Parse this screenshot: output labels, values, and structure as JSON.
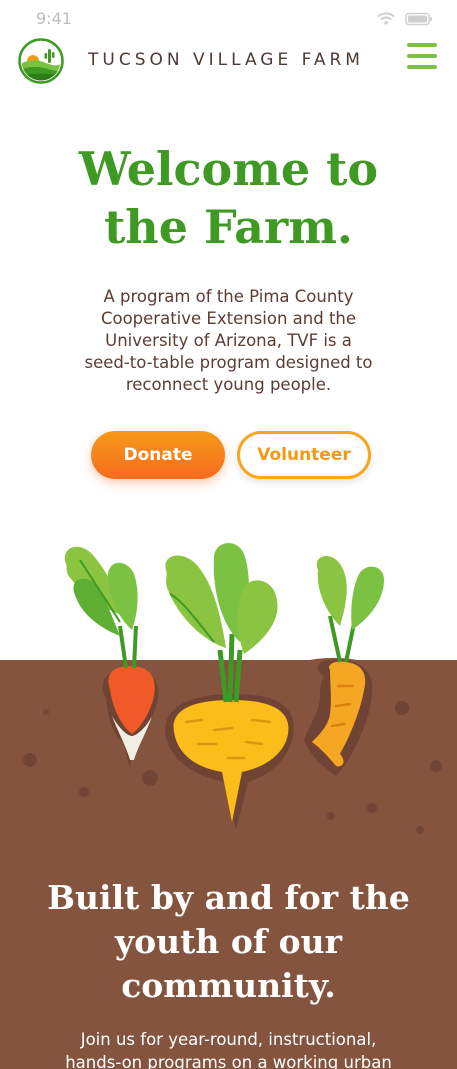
{
  "status_bar": {
    "time": "9:41"
  },
  "header": {
    "brand": "TUCSON VILLAGE FARM",
    "logo_icon": "farm-sunrise-cactus-logo",
    "menu_icon": "hamburger-menu-icon"
  },
  "hero": {
    "title_line1": "Welcome to",
    "title_line2": "the Farm.",
    "description_line1": "A program of the Pima County",
    "description_line2": "Cooperative Extension and the",
    "description_line3": "University of Arizona, TVF is a",
    "description_line4": "seed-to-table program designed to",
    "description_line5": "reconnect young people."
  },
  "actions": {
    "donate_label": "Donate",
    "volunteer_label": "Volunteer"
  },
  "section": {
    "title_line1": "Built by and for the",
    "title_line2": "youth of our",
    "title_line3": "community.",
    "text_line1": "Join us for year-round, instructional,",
    "text_line2": "hands-on programs on a working urban"
  },
  "colors": {
    "brand_green": "#3f9a24",
    "menu_green": "#7cc242",
    "orange": "#f56b1d",
    "soil_brown": "#84543f"
  }
}
